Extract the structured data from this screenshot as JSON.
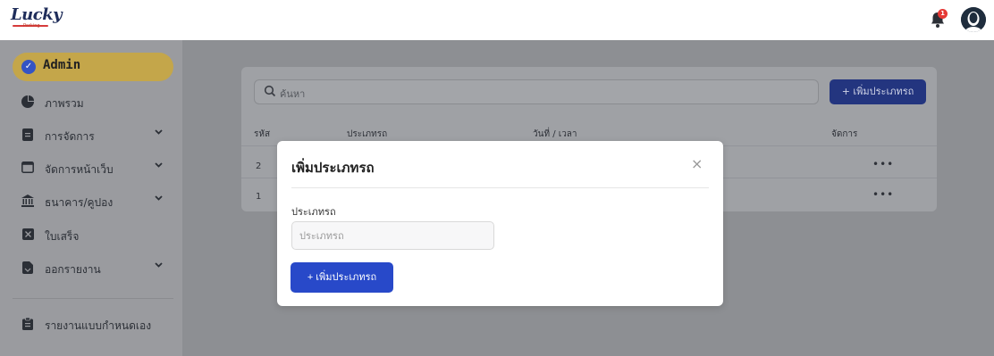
{
  "header": {
    "logo_text": "Lucky",
    "logo_sub": "Parking",
    "notification_count": "1"
  },
  "sidebar": {
    "admin_label": "Admin",
    "items": [
      {
        "label": "ภาพรวม",
        "icon": "pie-chart-icon",
        "chevron": false
      },
      {
        "label": "การจัดการ",
        "icon": "document-icon",
        "chevron": true
      },
      {
        "label": "จัดการหน้าเว็บ",
        "icon": "window-icon",
        "chevron": true
      },
      {
        "label": "ธนาคาร/คูปอง",
        "icon": "bank-icon",
        "chevron": true
      },
      {
        "label": "ใบเสร็จ",
        "icon": "receipt-icon",
        "chevron": false
      },
      {
        "label": "ออกรายงาน",
        "icon": "report-icon",
        "chevron": true
      },
      {
        "label": "รายงานแบบกำหนดเอง",
        "icon": "clipboard-icon",
        "chevron": false
      }
    ]
  },
  "main": {
    "search_placeholder": "ค้นหา",
    "add_button": "+ เพิ่มประเภทรถ",
    "table": {
      "headers": [
        "รหัส",
        "ประเภทรถ",
        "วันที่ / เวลา",
        "จัดการ"
      ],
      "rows": [
        {
          "id": "2",
          "action": "•••"
        },
        {
          "id": "1",
          "action": "•••"
        }
      ]
    }
  },
  "modal": {
    "title": "เพิ่มประเภทรถ",
    "close": "×",
    "field_label": "ประเภทรถ",
    "field_placeholder": "ประเภทรถ",
    "field_value": "",
    "submit_label": "+  เพิ่มประเภทรถ"
  },
  "colors": {
    "accent": "#2849c9",
    "admin_pill": "#c4a64a",
    "overlay": "#8d8f93"
  }
}
